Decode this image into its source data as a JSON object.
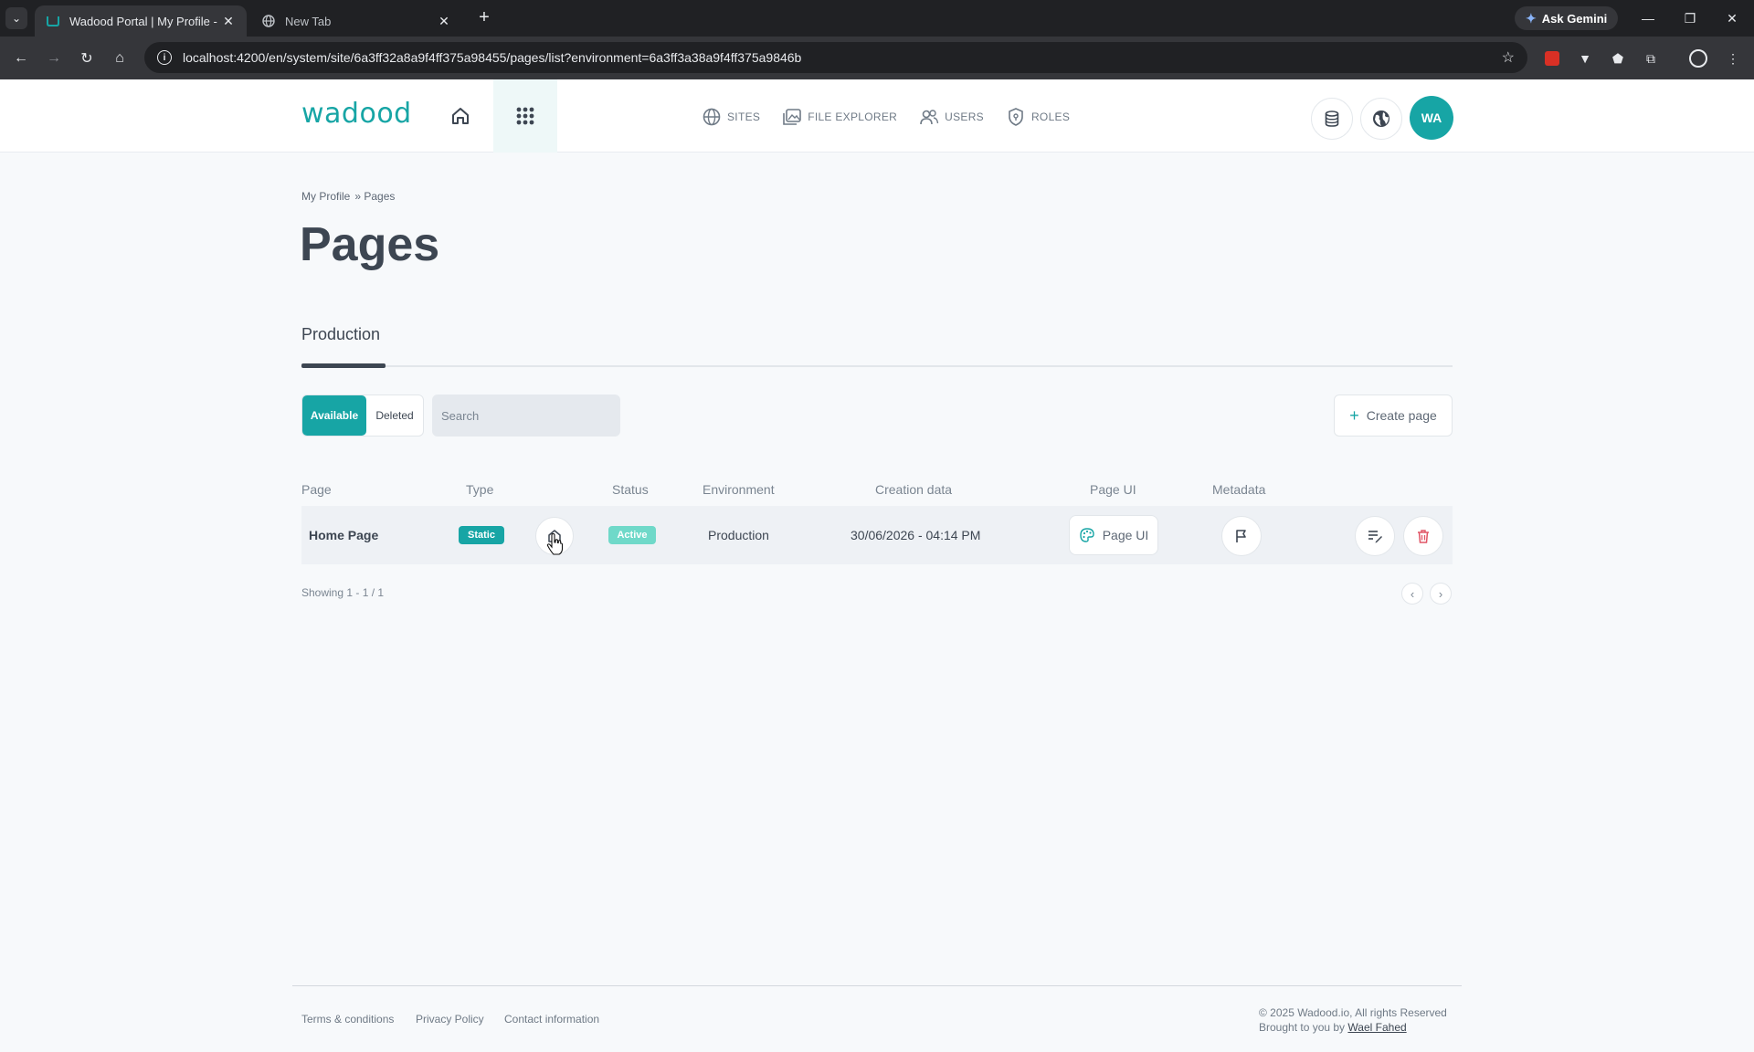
{
  "browser": {
    "tabs": [
      {
        "title": "Wadood Portal | My Profile - Pa",
        "active": true
      },
      {
        "title": "New Tab",
        "active": false
      }
    ],
    "url": "localhost:4200/en/system/site/6a3ff32a8a9f4ff375a98455/pages/list?environment=6a3ff3a38a9f4ff375a9846b",
    "gemini_label": "Ask Gemini"
  },
  "header": {
    "logo_text": "wadood",
    "nav": [
      {
        "label": "SITES",
        "icon": "globe-icon"
      },
      {
        "label": "FILE EXPLORER",
        "icon": "images-icon"
      },
      {
        "label": "USERS",
        "icon": "users-icon"
      },
      {
        "label": "ROLES",
        "icon": "shield-icon"
      }
    ],
    "avatar_initials": "WA"
  },
  "breadcrumb": {
    "items": [
      "My Profile",
      "» Pages"
    ]
  },
  "page_title": "Pages",
  "environment_tab": "Production",
  "filters": {
    "available_label": "Available",
    "deleted_label": "Deleted",
    "search_placeholder": "Search",
    "active_filter": "Available"
  },
  "create_button_label": "Create page",
  "table": {
    "headers": [
      "Page",
      "Type",
      "Status",
      "Environment",
      "Creation data",
      "Page UI",
      "Metadata"
    ],
    "rows": [
      {
        "page": "Home Page",
        "type": "Static",
        "status": "Active",
        "environment": "Production",
        "created": "30/06/2026 - 04:14 PM",
        "page_ui_label": "Page UI"
      }
    ]
  },
  "pagination": {
    "showing": "Showing 1 - 1 / 1"
  },
  "footer": {
    "links": [
      "Terms & conditions",
      "Privacy Policy",
      "Contact information"
    ],
    "copyright": "© 2025 Wadood.io, All rights Reserved",
    "brought_by": "Brought to you by",
    "author": "Wael Fahed"
  },
  "colors": {
    "brand": "#17a5a5",
    "static_badge": "#17a5a5",
    "active_badge": "#6fd9c9",
    "delete": "#e05566"
  }
}
